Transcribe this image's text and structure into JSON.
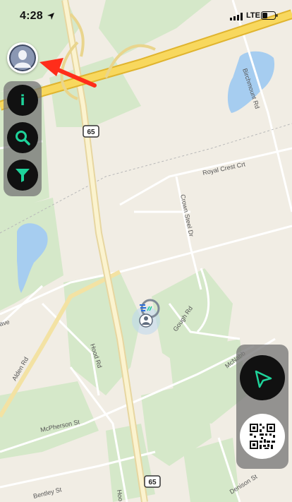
{
  "status_bar": {
    "time": "4:28",
    "network": "LTE",
    "icons": [
      "location-arrow-icon",
      "signal-icon",
      "battery-icon"
    ]
  },
  "map": {
    "road_labels": {
      "birchmount": "Birchmount Rd",
      "royal_crest": "Royal Crest Crt",
      "crown_steel": "Crown Steel Dr",
      "gough": "Gough Rd",
      "hood": "Hood Rd",
      "alden": "Alden Rd",
      "mcpherson": "McPherson St",
      "bentley": "Bentley St",
      "mcnabb": "McNabb",
      "denison": "Denison St",
      "ave": "ave",
      "hoo": "Hoo"
    },
    "highway_shields": [
      "65",
      "65"
    ]
  },
  "controls": {
    "left": {
      "profile": "avatar-icon",
      "info": "i",
      "search": "search-icon",
      "filter": "filter-icon"
    },
    "right": {
      "navigate": "navigation-arrow-icon",
      "qr": "qr-code-icon"
    }
  },
  "annotation": {
    "arrow_color": "#ff2d1a"
  },
  "colors": {
    "accent": "#1ed39a",
    "map_background": "#f1ede4",
    "park_green": "#cfe6c3",
    "highway": "#f7d45a",
    "water": "#9dc6ef"
  }
}
